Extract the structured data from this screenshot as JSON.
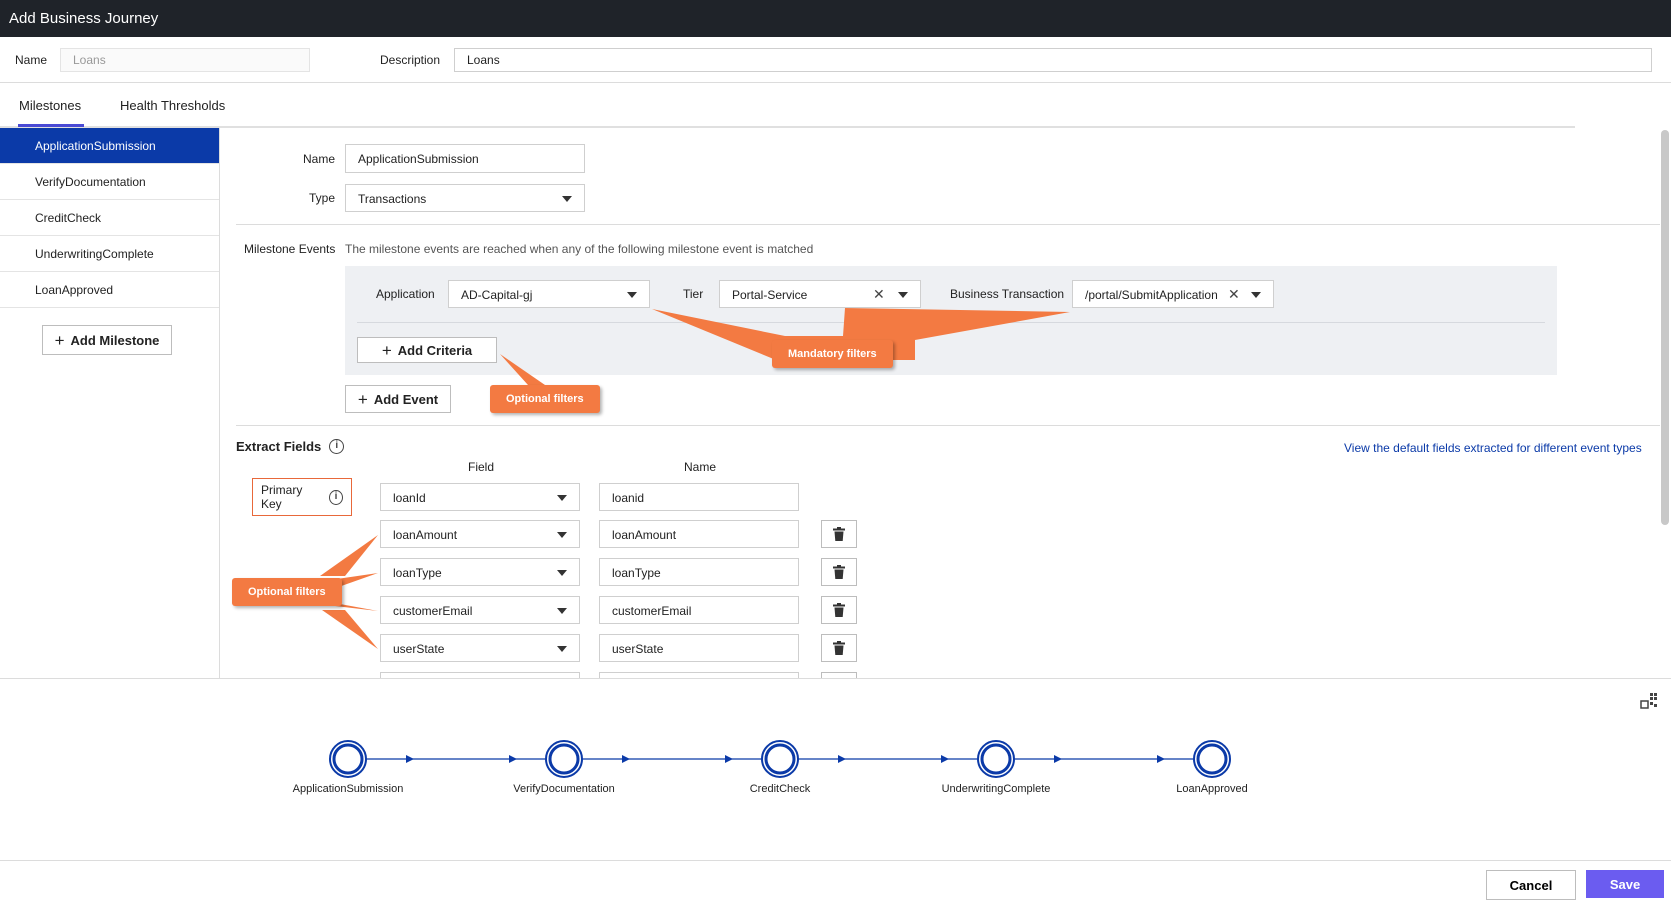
{
  "window": {
    "title": "Add Business Journey"
  },
  "journey": {
    "name_label": "Name",
    "name_placeholder": "Loans",
    "description_label": "Description",
    "description_value": "Loans"
  },
  "tabs": [
    {
      "label": "Milestones"
    },
    {
      "label": "Health Thresholds"
    }
  ],
  "sidebar": {
    "items": [
      {
        "label": "ApplicationSubmission"
      },
      {
        "label": "VerifyDocumentation"
      },
      {
        "label": "CreditCheck"
      },
      {
        "label": "UnderwritingComplete"
      },
      {
        "label": "LoanApproved"
      }
    ],
    "add_button": "Add Milestone"
  },
  "milestone": {
    "name_label": "Name",
    "name_value": "ApplicationSubmission",
    "type_label": "Type",
    "type_value": "Transactions",
    "events_label": "Milestone Events",
    "events_hint": "The milestone events are reached when any of the following milestone event is matched",
    "application_label": "Application",
    "application_value": "AD-Capital-gj",
    "tier_label": "Tier",
    "tier_value": "Portal-Service",
    "bt_label": "Business Transaction",
    "bt_value": "/portal/SubmitApplication",
    "add_criteria": "Add Criteria",
    "add_event": "Add Event"
  },
  "extract": {
    "title": "Extract Fields",
    "link": "View the default fields extracted for different event types",
    "field_header": "Field",
    "name_header": "Name",
    "primary_key": "Primary Key",
    "rows": [
      {
        "field": "loanId",
        "name": "loanid"
      },
      {
        "field": "loanAmount",
        "name": "loanAmount"
      },
      {
        "field": "loanType",
        "name": "loanType"
      },
      {
        "field": "customerEmail",
        "name": "customerEmail"
      },
      {
        "field": "userState",
        "name": "userState"
      }
    ]
  },
  "callouts": {
    "mandatory": "Mandatory filters",
    "optional_top": "Optional filters",
    "optional_left": "Optional filters"
  },
  "flow": {
    "nodes": [
      {
        "label": "ApplicationSubmission"
      },
      {
        "label": "VerifyDocumentation"
      },
      {
        "label": "CreditCheck"
      },
      {
        "label": "UnderwritingComplete"
      },
      {
        "label": "LoanApproved"
      }
    ]
  },
  "footer": {
    "cancel": "Cancel",
    "save": "Save"
  },
  "colors": {
    "accent": "#0b3aa8",
    "save": "#6b5cf0",
    "callout": "#f37a42",
    "titlebar": "#1f2329"
  }
}
